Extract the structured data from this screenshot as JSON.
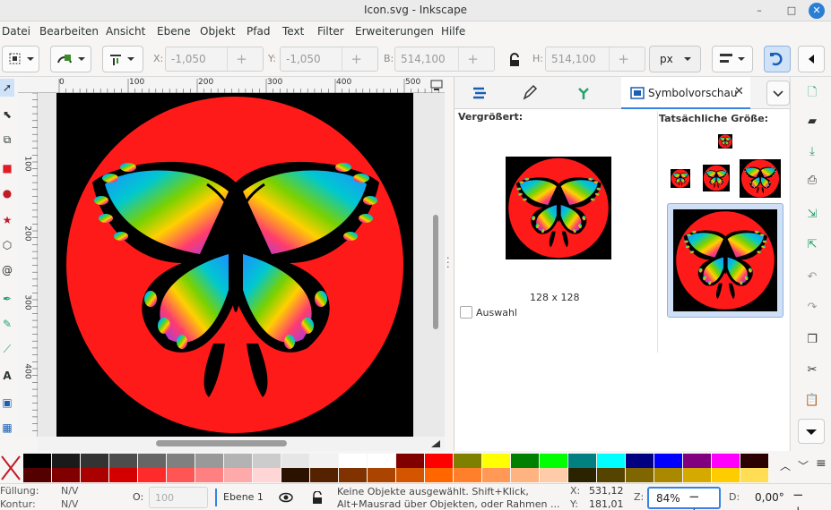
{
  "window": {
    "title": "Icon.svg - Inkscape",
    "minimize": "–",
    "maximize": "□",
    "close": "✕"
  },
  "menu": [
    "Datei",
    "Bearbeiten",
    "Ansicht",
    "Ebene",
    "Objekt",
    "Pfad",
    "Text",
    "Filter",
    "Erweiterungen",
    "Hilfe"
  ],
  "toolbar": {
    "x_label": "X:",
    "x_value": "-1,050",
    "y_label": "Y:",
    "y_value": "-1,050",
    "b_label": "B:",
    "b_value": "514,100",
    "h_label": "H:",
    "h_value": "514,100",
    "unit": "px"
  },
  "ruler": {
    "h_ticks": [
      "0",
      "100",
      "200",
      "300",
      "400",
      "500"
    ],
    "v_ticks": [
      "100",
      "200",
      "300",
      "400"
    ]
  },
  "dock": {
    "tab_label": "Symbolvorschau",
    "enlarged_label": "Vergrößert:",
    "actual_size_label": "Tatsächliche Größe:",
    "size_caption": "128 x 128",
    "selection_label": "Auswahl"
  },
  "palette_colors": [
    "#000000",
    "#1a1a1a",
    "#333333",
    "#4d4d4d",
    "#666666",
    "#808080",
    "#999999",
    "#b3b3b3",
    "#cccccc",
    "#e6e6e6",
    "#f2f2f2",
    "#ffffff",
    "#ffffff",
    "#800000",
    "#ff0000",
    "#808000",
    "#ffff00",
    "#008000",
    "#00ff00",
    "#008080",
    "#00ffff",
    "#000080",
    "#0000ff",
    "#800080",
    "#ff00ff",
    "#2b0000"
  ],
  "palette_colors2": [
    "#550000",
    "#800000",
    "#aa0000",
    "#d40000",
    "#ff2a2a",
    "#ff5555",
    "#ff8080",
    "#ffaaaa",
    "#ffd5d5",
    "#2b1100",
    "#552200",
    "#803300",
    "#aa4400",
    "#d45500",
    "#ff6600",
    "#ff7f2a",
    "#ff9955",
    "#ffb380",
    "#ffccaa",
    "#2b2200",
    "#554400",
    "#806600",
    "#aa8800",
    "#d4aa00",
    "#ffcc00",
    "#ffdd55"
  ],
  "status": {
    "fill_label": "Füllung:",
    "fill_value": "N/V",
    "stroke_label": "Kontur:",
    "stroke_value": "N/V",
    "opacity_label": "O:",
    "opacity_value": "100",
    "layer": "Ebene 1",
    "message_line1": "Keine Objekte ausgewählt. Shift+Klick,",
    "message_line2": "Alt+Mausrad über Objekten, oder Rahmen ...",
    "cx_label": "X:",
    "cx_value": "531,12",
    "cy_label": "Y:",
    "cy_value": "181,01",
    "zoom_label": "Z:",
    "zoom_value": "84%",
    "rot_label": "D:",
    "rot_value": "0,00°"
  }
}
